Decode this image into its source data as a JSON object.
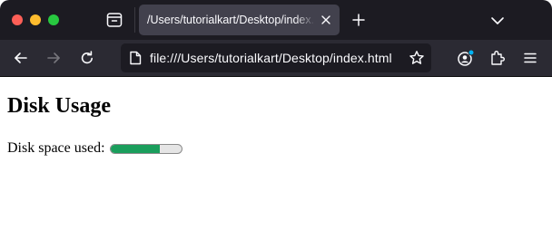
{
  "browser": {
    "tab": {
      "title": "/Users/tutorialkart/Desktop/index.html"
    },
    "url": "file:///Users/tutorialkart/Desktop/index.html",
    "icons": {
      "window_close": "traffic-light-close",
      "window_minimize": "traffic-light-minimize",
      "window_maximize": "traffic-light-maximize",
      "tab_manager": "tab-manager-icon",
      "tab_close": "close-icon",
      "new_tab": "plus-icon",
      "tab_list": "chevron-down-icon",
      "back": "arrow-left-icon",
      "forward": "arrow-right-icon",
      "reload": "reload-icon",
      "page": "page-icon",
      "bookmark": "star-icon",
      "account": "account-icon",
      "extensions": "puzzle-icon",
      "menu": "hamburger-icon"
    },
    "colors": {
      "tabstrip": "#1c1b22",
      "toolbar": "#2b2a33",
      "active_tab": "#42414d",
      "account_badge": "#00b3f4"
    }
  },
  "page": {
    "heading": "Disk Usage",
    "disk_label": "Disk space used:",
    "meter": {
      "value": 0.7,
      "fill_color": "#1a9e5c",
      "track_color": "#e5e5e5"
    }
  }
}
